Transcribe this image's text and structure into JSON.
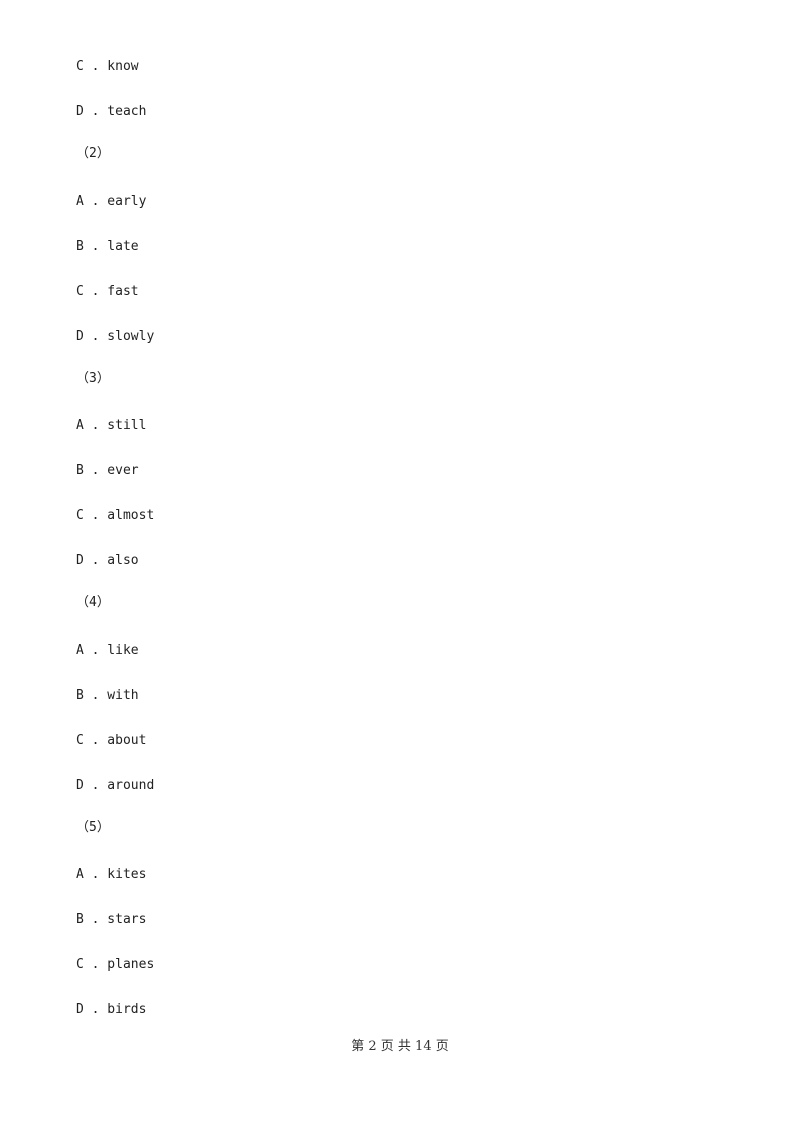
{
  "lines": [
    {
      "type": "option",
      "text": "C . know"
    },
    {
      "type": "option",
      "text": "D . teach"
    },
    {
      "type": "question",
      "text": "（2）"
    },
    {
      "type": "option",
      "text": "A . early"
    },
    {
      "type": "option",
      "text": "B . late"
    },
    {
      "type": "option",
      "text": "C . fast"
    },
    {
      "type": "option",
      "text": "D . slowly"
    },
    {
      "type": "question",
      "text": "（3）"
    },
    {
      "type": "option",
      "text": "A . still"
    },
    {
      "type": "option",
      "text": "B . ever"
    },
    {
      "type": "option",
      "text": "C . almost"
    },
    {
      "type": "option",
      "text": "D . also"
    },
    {
      "type": "question",
      "text": "（4）"
    },
    {
      "type": "option",
      "text": "A . like"
    },
    {
      "type": "option",
      "text": "B . with"
    },
    {
      "type": "option",
      "text": "C . about"
    },
    {
      "type": "option",
      "text": "D . around"
    },
    {
      "type": "question",
      "text": "（5）"
    },
    {
      "type": "option",
      "text": "A . kites"
    },
    {
      "type": "option",
      "text": "B . stars"
    },
    {
      "type": "option",
      "text": "C . planes"
    },
    {
      "type": "option",
      "text": "D . birds"
    }
  ],
  "footer": {
    "text": "第 2 页 共 14 页"
  }
}
